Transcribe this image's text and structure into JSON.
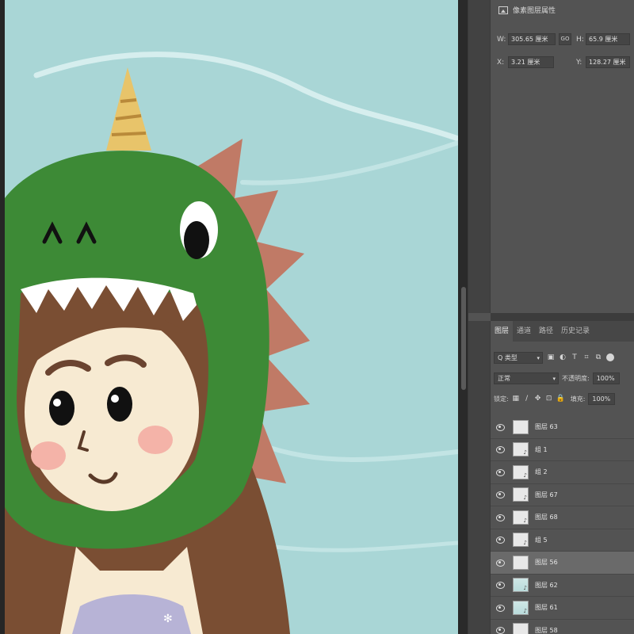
{
  "properties": {
    "title": "像素图层属性",
    "w_label": "W:",
    "w_value": "305.65 厘米",
    "link_label": "GO",
    "h_label": "H:",
    "h_value": "65.9 厘米",
    "x_label": "X:",
    "x_value": "3.21 厘米",
    "y_label": "Y:",
    "y_value": "128.27 厘米"
  },
  "layers_panel": {
    "tabs": [
      {
        "label": "图层",
        "active": true
      },
      {
        "label": "通道",
        "active": false
      },
      {
        "label": "路径",
        "active": false
      },
      {
        "label": "历史记录",
        "active": false
      }
    ],
    "filter_kind": "Q 类型",
    "blend_mode": "正常",
    "opacity_label": "不透明度:",
    "opacity_value": "100%",
    "lock_label": "锁定:",
    "fill_label": "填充:",
    "fill_value": "100%",
    "layers": [
      {
        "name": "图层 63",
        "selected": false
      },
      {
        "name": "组 1",
        "selected": false
      },
      {
        "name": "组 2",
        "selected": false
      },
      {
        "name": "图层 67",
        "selected": false
      },
      {
        "name": "图层 68",
        "selected": false
      },
      {
        "name": "组 5",
        "selected": false
      },
      {
        "name": "图层 56",
        "selected": true
      },
      {
        "name": "图层 62",
        "selected": false
      },
      {
        "name": "图层 61",
        "selected": false
      },
      {
        "name": "图层 58",
        "selected": false
      }
    ]
  },
  "colors": {
    "sky": "#a9d6d6",
    "dino_green": "#3d8a36",
    "spikes": "#c07a66",
    "hair": "#7a4e33",
    "skin": "#f7ead2",
    "horn": "#e8c46a",
    "panel_bg": "#535353"
  },
  "icons": [
    "image-icon",
    "eye-icon",
    "lock-icon",
    "brush-icon",
    "move-icon",
    "artboard-icon",
    "text-icon"
  ]
}
